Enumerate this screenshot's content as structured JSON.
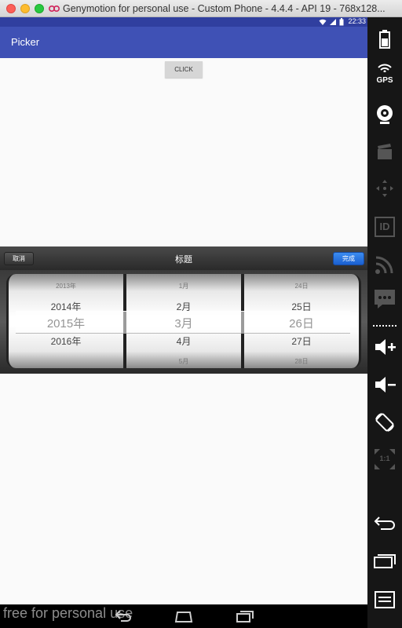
{
  "window": {
    "title": "Genymotion for personal use - Custom Phone - 4.4.4 - API 19 - 768x128..."
  },
  "status_bar": {
    "time": "22:33"
  },
  "app": {
    "title": "Picker"
  },
  "click_button": {
    "label": "CLICK"
  },
  "picker": {
    "cancel_label": "取消",
    "title": "标题",
    "done_label": "完成",
    "years": [
      "2013年",
      "2014年",
      "2015年",
      "2016年",
      ""
    ],
    "months": [
      "1月",
      "2月",
      "3月",
      "4月",
      "5月"
    ],
    "days": [
      "24日",
      "25日",
      "26日",
      "27日",
      "28日"
    ],
    "selected": {
      "year": "2015年",
      "month": "3月",
      "day": "26日"
    }
  },
  "sidebar": {
    "gps_label": "GPS",
    "id_label": "ID",
    "ratio_label": "1:1"
  },
  "bottom_bar": {
    "watermark": "free for personal use"
  }
}
